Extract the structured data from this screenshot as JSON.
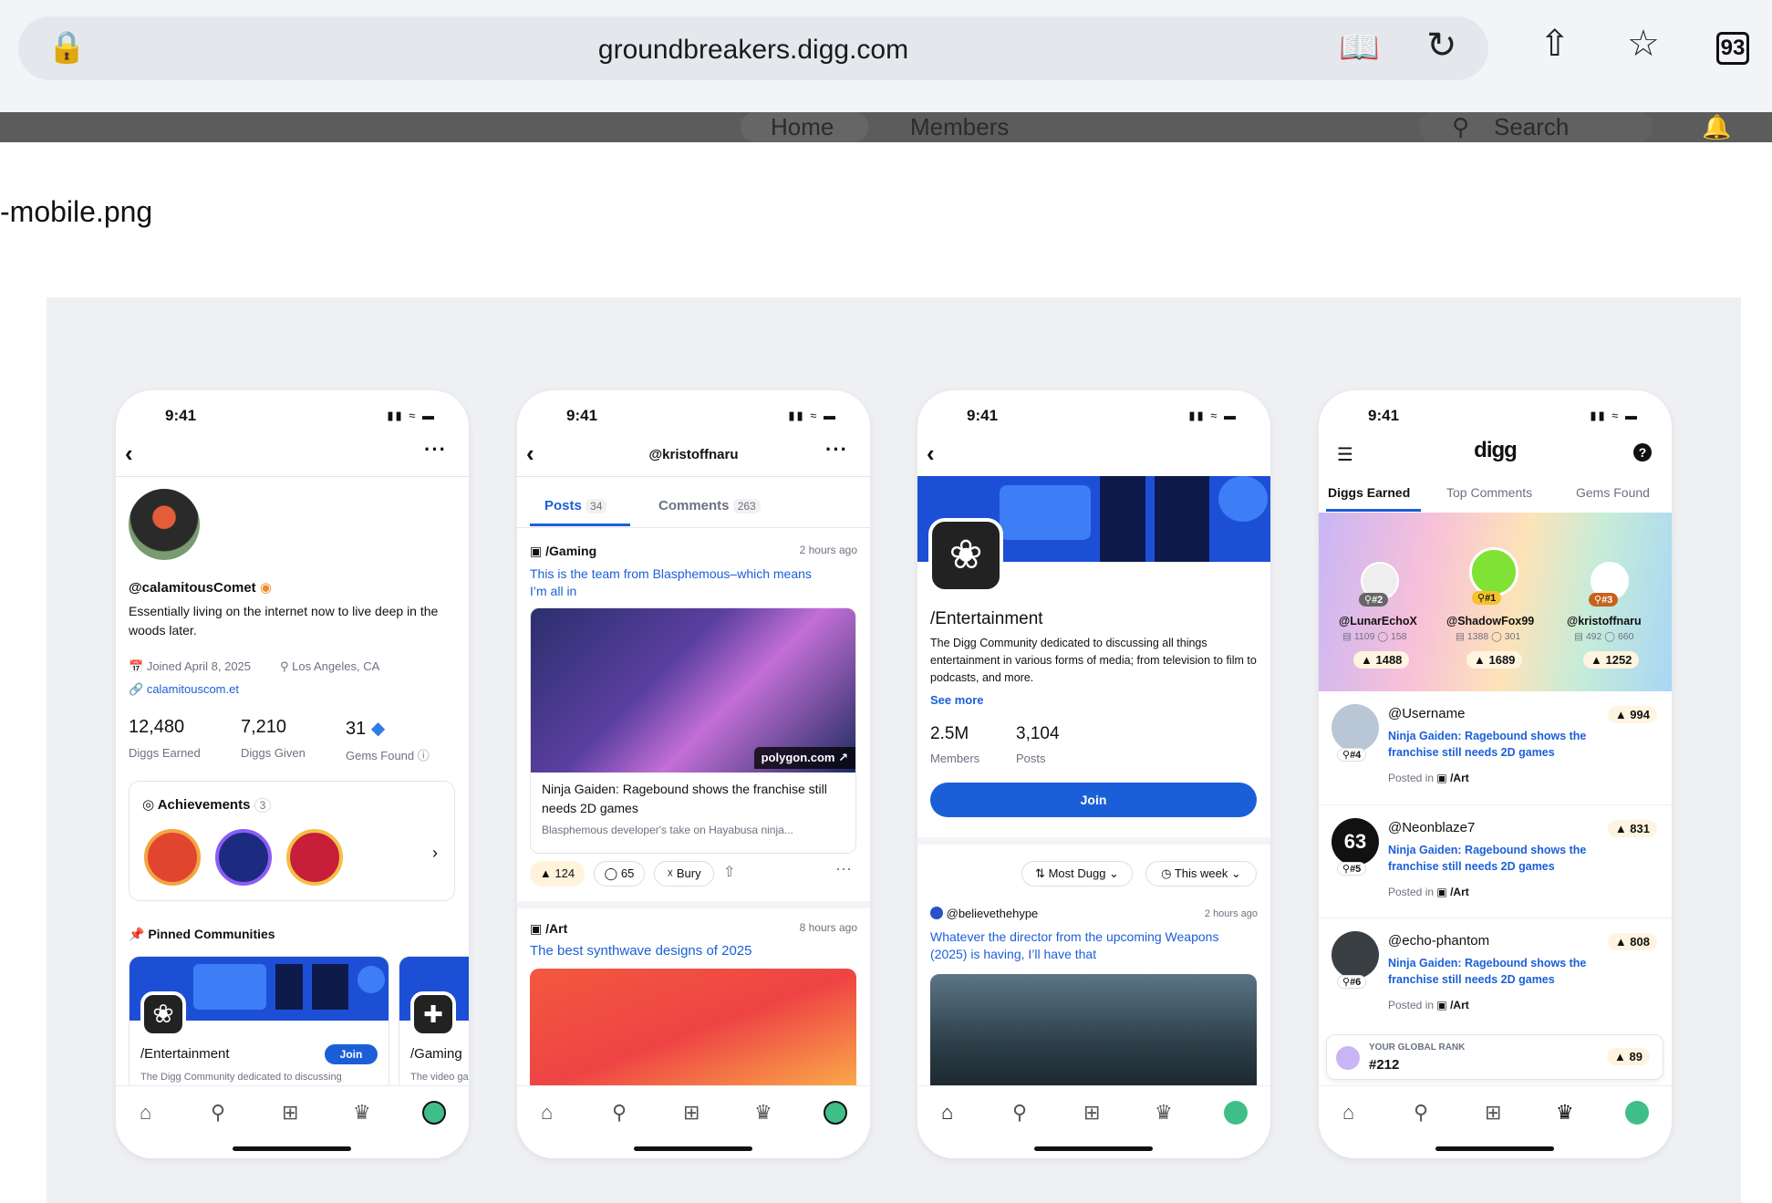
{
  "browser": {
    "url": "groundbreakers.digg.com",
    "tab_count": "93",
    "nav_items": [
      "Home",
      "Members"
    ],
    "search_label": "Search"
  },
  "page": {
    "filename": "-mobile.png"
  },
  "status_time": "9:41",
  "profile": {
    "username": "@calamitousComet",
    "bio": "Essentially living on the internet now to live deep in the woods later.",
    "joined": "Joined April 8, 2025",
    "location": "Los Angeles, CA",
    "link": "calamitouscom.et",
    "stats": [
      {
        "value": "12,480",
        "label": "Diggs Earned"
      },
      {
        "value": "7,210",
        "label": "Diggs Given"
      },
      {
        "value": "31",
        "label": "Gems Found"
      }
    ],
    "achievements_label": "Achievements",
    "achievements_count": "3",
    "pinned_label": "Pinned Communities",
    "pinned": [
      {
        "name": "/Entertainment",
        "desc": "The Digg Community dedicated to discussing",
        "join": "Join"
      },
      {
        "name": "/Gaming",
        "desc": "The video ga"
      }
    ]
  },
  "posts_screen": {
    "title": "@kristoffnaru",
    "tabs": [
      {
        "label": "Posts",
        "count": "34"
      },
      {
        "label": "Comments",
        "count": "263"
      }
    ],
    "post1": {
      "community": "/Gaming",
      "time": "2 hours ago",
      "title": "This is the team from Blasphemous–which means I’m all in",
      "source": "polygon.com",
      "link_title": "Ninja Gaiden: Ragebound shows the franchise still needs 2D games",
      "link_desc": "Blasphemous developer's take on Hayabusa ninja...",
      "diggs": "124",
      "comments": "65",
      "bury": "Bury"
    },
    "post2": {
      "community": "/Art",
      "time": "8 hours ago",
      "title": "The best synthwave designs of 2025"
    }
  },
  "community_screen": {
    "name": "/Entertainment",
    "desc": "The Digg Community dedicated to discussing all things entertainment in various forms of media; from television to film to podcasts, and more.",
    "see_more": "See more",
    "members_value": "2.5M",
    "members_label": "Members",
    "posts_value": "3,104",
    "posts_label": "Posts",
    "join": "Join",
    "sort": "Most Dugg",
    "range": "This week",
    "post_user": "@believethehype",
    "post_time": "2 hours ago",
    "post_title": "Whatever the director from the upcoming Weapons (2025) is having, I’ll have that"
  },
  "leader_screen": {
    "logo": "digg",
    "tabs": [
      "Diggs Earned",
      "Top Comments",
      "Gems Found"
    ],
    "podium": [
      {
        "rank": "#2",
        "user": "@LunarEchoX",
        "posts": "1109",
        "comments": "158",
        "diggs": "1488"
      },
      {
        "rank": "#1",
        "user": "@ShadowFox99",
        "posts": "1388",
        "comments": "301",
        "diggs": "1689"
      },
      {
        "rank": "#3",
        "user": "@kristoffnaru",
        "posts": "492",
        "comments": "660",
        "diggs": "1252"
      }
    ],
    "rows": [
      {
        "rank": "#4",
        "user": "@Username",
        "diggs": "994",
        "title": "Ninja Gaiden: Ragebound shows the franchise still needs 2D games",
        "posted": "Posted in",
        "community": "/Art"
      },
      {
        "rank": "#5",
        "user": "@Neonblaze7",
        "diggs": "831",
        "title": "Ninja Gaiden: Ragebound shows the franchise still needs 2D games",
        "posted": "Posted in",
        "community": "/Art"
      },
      {
        "rank": "#6",
        "user": "@echo-phantom",
        "diggs": "808",
        "title": "Ninja Gaiden: Ragebound shows the franchise still needs 2D games",
        "posted": "Posted in",
        "community": "/Art"
      }
    ],
    "global_rank_label": "YOUR GLOBAL RANK",
    "global_rank": "#212",
    "global_diggs": "89",
    "avatar_initials": "63"
  }
}
